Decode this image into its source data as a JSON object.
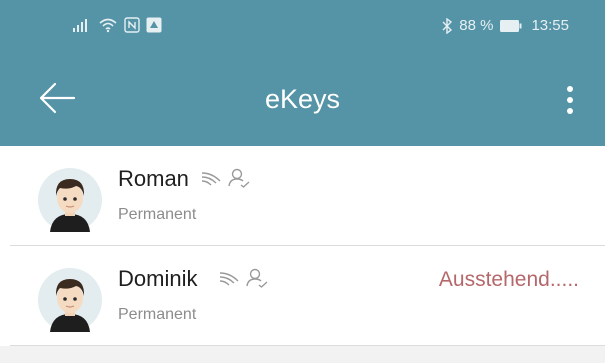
{
  "status_bar": {
    "battery_percent": "88 %",
    "time": "13:55",
    "icons": [
      "signal-icon",
      "wifi-icon",
      "nfc-icon",
      "app-notification-icon",
      "bluetooth-icon",
      "battery-icon"
    ]
  },
  "app_bar": {
    "title": "eKeys",
    "back_icon": "arrow-left-icon",
    "menu_icon": "more-vertical-icon"
  },
  "ekeys": [
    {
      "name": "Roman",
      "validity": "Permanent",
      "status": "",
      "icons": [
        "wireless-icon",
        "user-check-icon"
      ]
    },
    {
      "name": "Dominik",
      "validity": "Permanent",
      "status": "Ausstehend.....",
      "icons": [
        "wireless-icon",
        "user-check-icon"
      ]
    }
  ],
  "colors": {
    "primary": "#5593a6",
    "status_pending": "#b5686b",
    "divider": "#dcdcdc",
    "subtext": "#8c8c8c"
  }
}
